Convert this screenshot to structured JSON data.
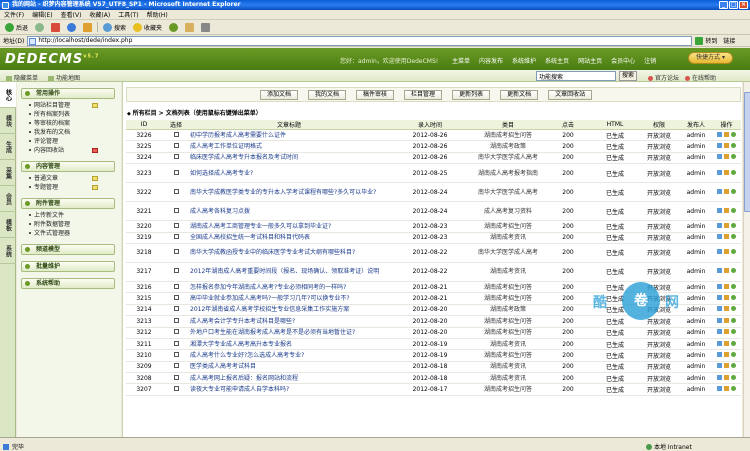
{
  "window": {
    "title": "我的网站 - 织梦内容管理系统 V57_UTF8_SP1 - Microsoft Internet Explorer"
  },
  "menu": [
    "文件(F)",
    "编辑(E)",
    "查看(V)",
    "收藏(A)",
    "工具(T)",
    "帮助(H)"
  ],
  "toolbar": {
    "back": "后退",
    "search": "搜索",
    "favorites": "收藏夹"
  },
  "address": {
    "label": "地址(D)",
    "url": "http://localhost/dede/index.php",
    "go": "转到",
    "links": "链接"
  },
  "header": {
    "logo": "DEDECMS",
    "version": "v5.7",
    "user_text": "您好：admin，欢迎使用DedeCMS!",
    "nav": [
      "主菜单",
      "内容发布",
      "系统维护",
      "系统主页",
      "网站主页",
      "会员中心",
      "注销"
    ],
    "quick_btn": "快捷方式"
  },
  "subbar": {
    "hide_menu": "隐藏菜单",
    "map": "功能地图",
    "search_placeholder": "功能搜索",
    "search_btn": "搜索",
    "forum": "官方论坛",
    "templates": "在线帮助"
  },
  "vtabs": [
    "核心",
    "模块",
    "生成",
    "采集",
    "会员",
    "模板",
    "系统"
  ],
  "sidebar": {
    "sections": [
      {
        "title": "常用操作",
        "items": [
          {
            "label": "网站栏目管理",
            "plus": true
          },
          {
            "label": "所有档案列表"
          },
          {
            "label": "等审核的档案"
          },
          {
            "label": "我发布的文档"
          },
          {
            "label": "评论管理"
          },
          {
            "label": "内容回收站",
            "plus": true,
            "red": true
          }
        ]
      },
      {
        "title": "内容管理",
        "items": [
          {
            "label": "普通文章",
            "plus": true
          },
          {
            "label": "专题管理",
            "plus": true
          }
        ]
      },
      {
        "title": "附件管理",
        "items": [
          {
            "label": "上传新文件"
          },
          {
            "label": "附件数据管理"
          },
          {
            "label": "文件式管理器"
          }
        ]
      },
      {
        "title": "频道模型",
        "items": []
      },
      {
        "title": "批量维护",
        "items": []
      },
      {
        "title": "系统帮助",
        "items": []
      }
    ]
  },
  "actions": [
    "添加文档",
    "我的文档",
    "稿件审核",
    "栏目管理",
    "更新列表",
    "更新文档",
    "文章回收站"
  ],
  "list_title": "所有栏目 > 文档列表（使用鼠标右键弹出菜单）",
  "table": {
    "headers": [
      "ID",
      "选择",
      "文章标题",
      "录入时间",
      "类目",
      "点击",
      "HTML",
      "权限",
      "发布人",
      "操作"
    ],
    "rows": [
      [
        "3226",
        "初中学历报考成人高考需要什么证件",
        "2012-08-26",
        "湖南成考招生问答",
        "200",
        "已生成",
        "开放浏览",
        "admin"
      ],
      [
        "3225",
        "成人高考工作单位证明格式",
        "2012-08-26",
        "湖南成考政策",
        "200",
        "已生成",
        "开放浏览",
        "admin"
      ],
      [
        "3224",
        "临床医学成人高考专升本报名及考试时间",
        "2012-08-26",
        "南华大学医学成人高考",
        "200",
        "已生成",
        "开放浏览",
        "admin"
      ],
      [
        "3223",
        "如何选择成人高考专业?",
        "2012-08-25",
        "湖南成人高考报考指南",
        "200",
        "已生成",
        "开放浏览",
        "admin"
      ],
      [
        "3222",
        "南华大学成教医学类专业的专升本入学考试课程有哪些?多久可以毕业?",
        "2012-08-24",
        "南华大学医学成人高考",
        "200",
        "已生成",
        "开放浏览",
        "admin"
      ],
      [
        "3221",
        "成人高考各科复习点拨",
        "2012-08-24",
        "成人高考复习资料",
        "200",
        "已生成",
        "开放浏览",
        "admin"
      ],
      [
        "3220",
        "湖南成人高考工商管理专业一般多久可以拿到毕业证?",
        "2012-08-23",
        "湖南成考招生问答",
        "200",
        "已生成",
        "开放浏览",
        "admin"
      ],
      [
        "3219",
        "全国成人高校招生统一考试科目和科目代码表",
        "2012-08-23",
        "湖南成考资讯",
        "200",
        "已生成",
        "开放浏览",
        "admin"
      ],
      [
        "3218",
        "南华大学成教函授专业中的临床医学专业考试大纲有哪些科目?",
        "2012-08-22",
        "南华大学医学成人高考",
        "200",
        "已生成",
        "开放浏览",
        "admin"
      ],
      [
        "3217",
        "2012年湖南成人高考重要时间段（报名、现场确认、领取准考证）说明",
        "2012-08-22",
        "湖南成考资讯",
        "200",
        "已生成",
        "开放浏览",
        "admin"
      ],
      [
        "3216",
        "怎样报名参加今年湖南成人高考?专业必须相同考的一样吗?",
        "2012-08-21",
        "湖南成考招生问答",
        "200",
        "已生成",
        "开放浏览",
        "admin"
      ],
      [
        "3215",
        "高中毕业就业参加成人高考吗?一般学习几年?可以换专业不?",
        "2012-08-21",
        "湖南成考招生问答",
        "200",
        "已生成",
        "开放浏览",
        "admin"
      ],
      [
        "3214",
        "2012年湖南省成人高考学校招生专业信息采集工作实施方案",
        "2012-08-20",
        "湖南成考政策",
        "200",
        "已生成",
        "开放浏览",
        "admin"
      ],
      [
        "3213",
        "成人高考会计学专升本考试科目是哪些?",
        "2012-08-20",
        "湖南成考招生问答",
        "200",
        "已生成",
        "开放浏览",
        "admin"
      ],
      [
        "3212",
        "外地户口考生能在湖南报考成人高考是不是必须有当地暂住证?",
        "2012-08-20",
        "湖南成考招生问答",
        "200",
        "已生成",
        "开放浏览",
        "admin"
      ],
      [
        "3211",
        "湘潭大学专业成人高考高升本专业报名",
        "2012-08-19",
        "湖南成考资讯",
        "200",
        "已生成",
        "开放浏览",
        "admin"
      ],
      [
        "3210",
        "成人高考什么专业好?怎么选成人高考专业?",
        "2012-08-19",
        "湖南成考招生问答",
        "200",
        "已生成",
        "开放浏览",
        "admin"
      ],
      [
        "3209",
        "医学类成人高考考试科目",
        "2012-08-18",
        "湖南成考资讯",
        "200",
        "已生成",
        "开放浏览",
        "admin"
      ],
      [
        "3208",
        "成人高考网上报名后疑：报名网站和流程",
        "2012-08-18",
        "湖南成考资讯",
        "200",
        "已生成",
        "开放浏览",
        "admin"
      ],
      [
        "3207",
        "读夜大专业可能申请成人自学本科吗?",
        "2012-08-17",
        "湖南成考招生问答",
        "200",
        "已生成",
        "开放浏览",
        "admin"
      ]
    ]
  },
  "watermark": {
    "left": "酷",
    "center": "卷",
    "right": "网"
  },
  "status": {
    "left": "完毕",
    "right": "本地 Intranet"
  }
}
